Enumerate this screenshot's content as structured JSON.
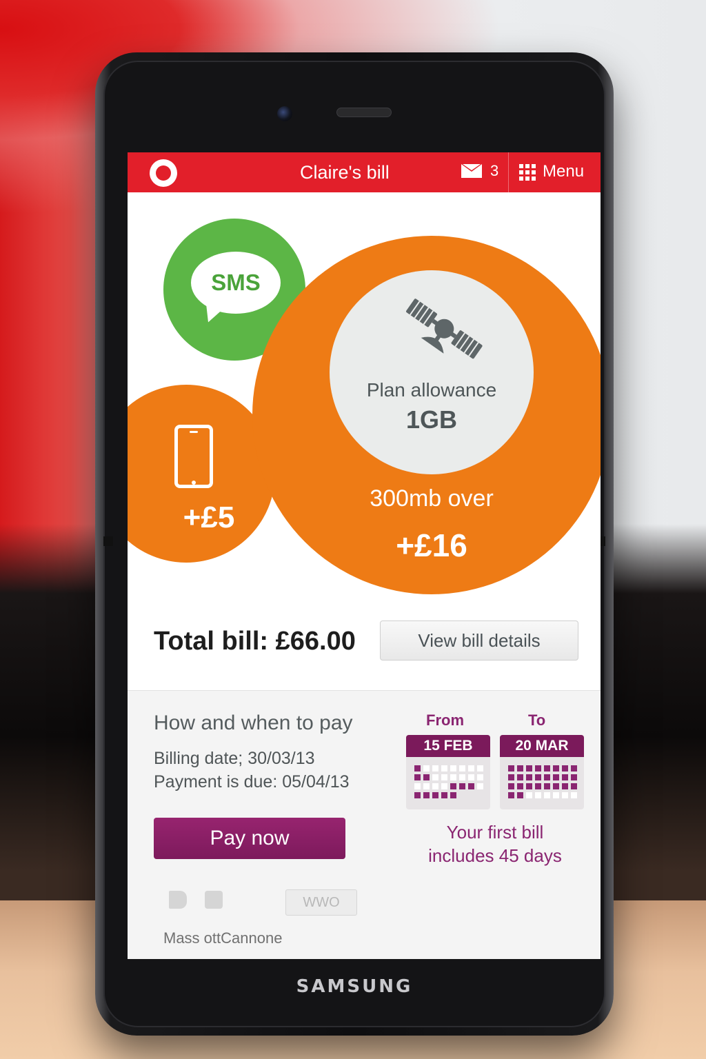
{
  "header": {
    "title": "Claire's bill",
    "messages_count": "3",
    "menu_label": "Menu"
  },
  "bubbles": {
    "sms_label": "SMS",
    "handset_price": "+£5",
    "allowance_label": "Plan allowance",
    "allowance_value": "1GB",
    "over_label": "300mb over",
    "over_price": "+£16"
  },
  "summary": {
    "total_label": "Total bill: £66.00",
    "view_details_label": "View bill details"
  },
  "payment": {
    "title": "How and when to pay",
    "billing_date": "Billing date; 30/03/13",
    "payment_due": "Payment is due: 05/04/13",
    "pay_now_label": "Pay now"
  },
  "period": {
    "from_label": "From",
    "to_label": "To",
    "from_date": "15 FEB",
    "to_date": "20 MAR",
    "note_line1": "Your first bill",
    "note_line2": "includes 45 days"
  },
  "footer": {
    "badge_text": "WWO",
    "caption": "Mass ottCannone"
  },
  "device": {
    "brand": "SAMSUNG"
  },
  "colors": {
    "brand_red": "#e21f2a",
    "sms_green": "#5cb646",
    "usage_orange": "#ee7b15",
    "accent_purple": "#7b1a5b"
  },
  "icons": [
    "logo-icon",
    "envelope-icon",
    "grid-menu-icon",
    "sms-speech-icon",
    "mobile-phone-icon",
    "satellite-icon",
    "calendar-icon",
    "speaker-icon",
    "camera-icon"
  ]
}
